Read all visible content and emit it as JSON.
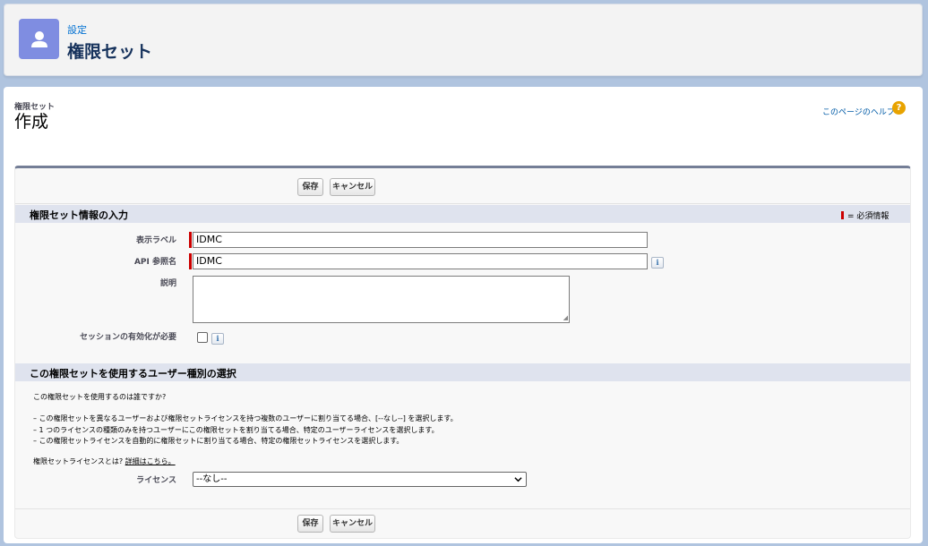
{
  "header": {
    "breadcrumb": "設定",
    "title": "権限セット",
    "icon": "user-icon",
    "icon_color": "#7f8de1"
  },
  "page": {
    "type_label": "権限セット",
    "title": "作成",
    "help_link": "このページのヘルプ",
    "help_icon": "?"
  },
  "buttons": {
    "save": "保存",
    "cancel": "キャンセル"
  },
  "section1": {
    "title": "権限セット情報の入力",
    "required_note": "= 必須情報",
    "fields": {
      "label_label": "表示ラベル",
      "label_value": "IDMC",
      "api_label": "API 参照名",
      "api_value": "IDMC",
      "description_label": "説明",
      "description_value": "",
      "session_label": "セッションの有効化が必要",
      "session_checked": false
    },
    "info_icon": "i"
  },
  "section2": {
    "title": "この権限セットを使用するユーザー種別の選択",
    "question": "この権限セットを使用するのは誰ですか?",
    "bullets": [
      "– この権限セットを異なるユーザーおよび権限セットライセンスを持つ複数のユーザーに割り当てる場合、[--なし--] を選択します。",
      "– 1 つのライセンスの種類のみを持つユーザーにこの権限セットを割り当てる場合、特定のユーザーライセンスを選択します。",
      "– この権限セットライセンスを自動的に権限セットに割り当てる場合、特定の権限セットライセンスを選択します。"
    ],
    "license_question": "権限セットライセンスとは?",
    "details_link": "詳細はこちら。",
    "license_label": "ライセンス",
    "license_selected": "--なし--"
  }
}
